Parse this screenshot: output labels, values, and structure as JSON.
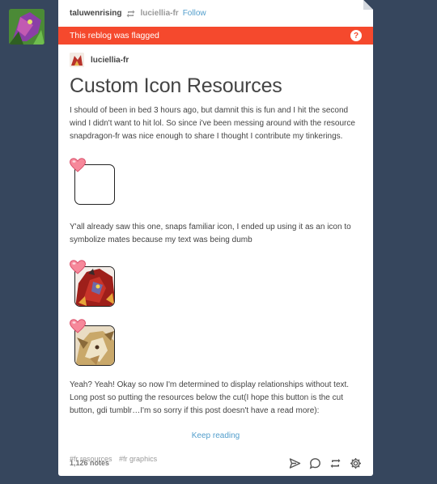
{
  "header": {
    "blog_name": "taluwenrising",
    "source_blog": "luciellia-fr",
    "follow_label": "Follow",
    "reblog_icon": "reblog-icon"
  },
  "flag": {
    "message": "This reblog was flagged",
    "help_label": "?",
    "color": "#f5492d"
  },
  "post": {
    "reblog_source": "luciellia-fr",
    "title": "Custom Icon Resources",
    "paragraph1": "I should of been in bed 3 hours ago, but damnit this is fun and I hit the second wind I didn't want to hit lol. So since i've been messing around with the resource snapdragon-fr was nice enough to share I thought I contribute my tinkerings.",
    "paragraph2": "Y'all already saw this one, snaps familiar icon, I ended up using it as an icon to symbolize mates because my text was being dumb",
    "paragraph3": "Yeah? Yeah! Okay so now I'm determined to display relationships without text. Long post so putting the resources below the cut(I hope this button is the cut button, gdi tumblr…I'm so sorry if this post doesn't have a read more):",
    "read_more": "Keep reading",
    "tags": [
      "#fr resources",
      "#fr graphics"
    ]
  },
  "footer": {
    "notes": "1,126 notes",
    "actions": [
      "share-icon",
      "reply-icon",
      "reblog-icon",
      "settings-icon"
    ]
  },
  "colors": {
    "background": "#36465d",
    "link": "#529ecc",
    "flag": "#f5492d"
  }
}
